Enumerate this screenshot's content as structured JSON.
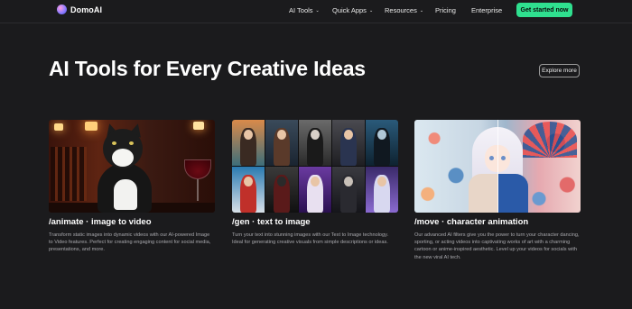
{
  "nav": {
    "logo_text": "DomoAI",
    "logo_icon": "domoai-logo-icon",
    "items": [
      {
        "label": "AI Tools",
        "has_dropdown": true
      },
      {
        "label": "Quick Apps",
        "has_dropdown": true
      },
      {
        "label": "Resources",
        "has_dropdown": true
      },
      {
        "label": "Pricing",
        "has_dropdown": false
      },
      {
        "label": "Enterprise",
        "has_dropdown": false
      }
    ],
    "cta_label": "Get started now",
    "chevron": "⌄"
  },
  "hero": {
    "title": "AI Tools for Every Creative Ideas",
    "explore_label": "Explore more"
  },
  "cards": [
    {
      "title": "/animate · image to video",
      "description": "Transform static images into dynamic videos with our AI-powered Image to Video features. Perfect for creating engaging content for social media, presentations, and more.",
      "image": "cat-at-bar-with-wine-image"
    },
    {
      "title": "/gen · text to image",
      "description": "Turn your text into stunning images with our Text to Image technology. Ideal for generating creative visuals from simple descriptions or ideas.",
      "image": "generated-characters-grid-image"
    },
    {
      "title": "/move · character animation",
      "description": "Our advanced AI filters give you the power to turn your character dancing, sporting, or acting videos into captivating works of art with a charming cartoon or anime-inspired aesthetic. Level up your videos for socials with the new viral AI tech.",
      "image": "anime-character-split-image"
    }
  ],
  "colors": {
    "background": "#1b1b1d",
    "cta": "#2fe08f",
    "muted_text": "#a8a8ad"
  }
}
